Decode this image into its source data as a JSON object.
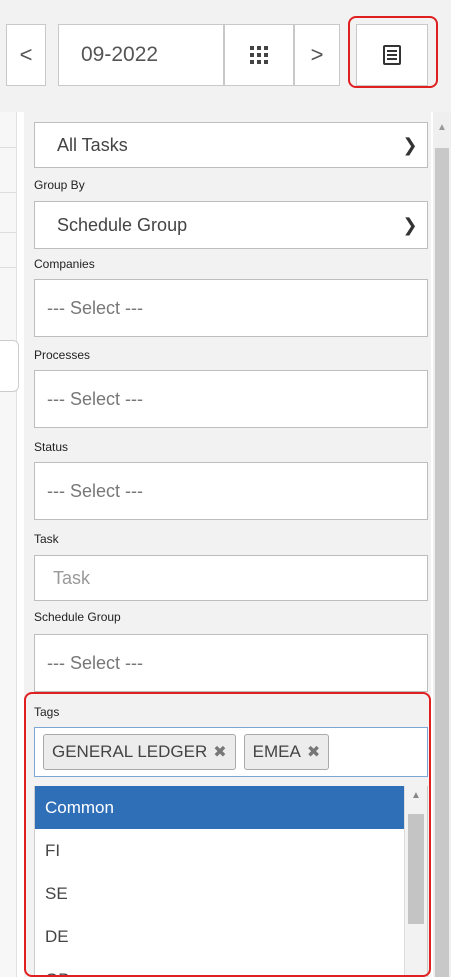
{
  "toolbar": {
    "prev_label": "<",
    "period_value": "09-2022",
    "next_label": ">"
  },
  "filters": {
    "task_filter": {
      "value": "All Tasks"
    },
    "group_by": {
      "label": "Group By",
      "value": "Schedule Group"
    },
    "companies": {
      "label": "Companies",
      "placeholder": "--- Select ---"
    },
    "processes": {
      "label": "Processes",
      "placeholder": "--- Select ---"
    },
    "status": {
      "label": "Status",
      "placeholder": "--- Select ---"
    },
    "task": {
      "label": "Task",
      "placeholder": "Task"
    },
    "schedule_group": {
      "label": "Schedule Group",
      "placeholder": "--- Select ---"
    },
    "tags": {
      "label": "Tags",
      "selected": [
        "GENERAL LEDGER",
        "EMEA"
      ],
      "options": [
        "Common",
        "FI",
        "SE",
        "DE",
        "GB"
      ]
    }
  },
  "highlight_color": "#e02020",
  "selected_option_color": "#2f6fb8"
}
